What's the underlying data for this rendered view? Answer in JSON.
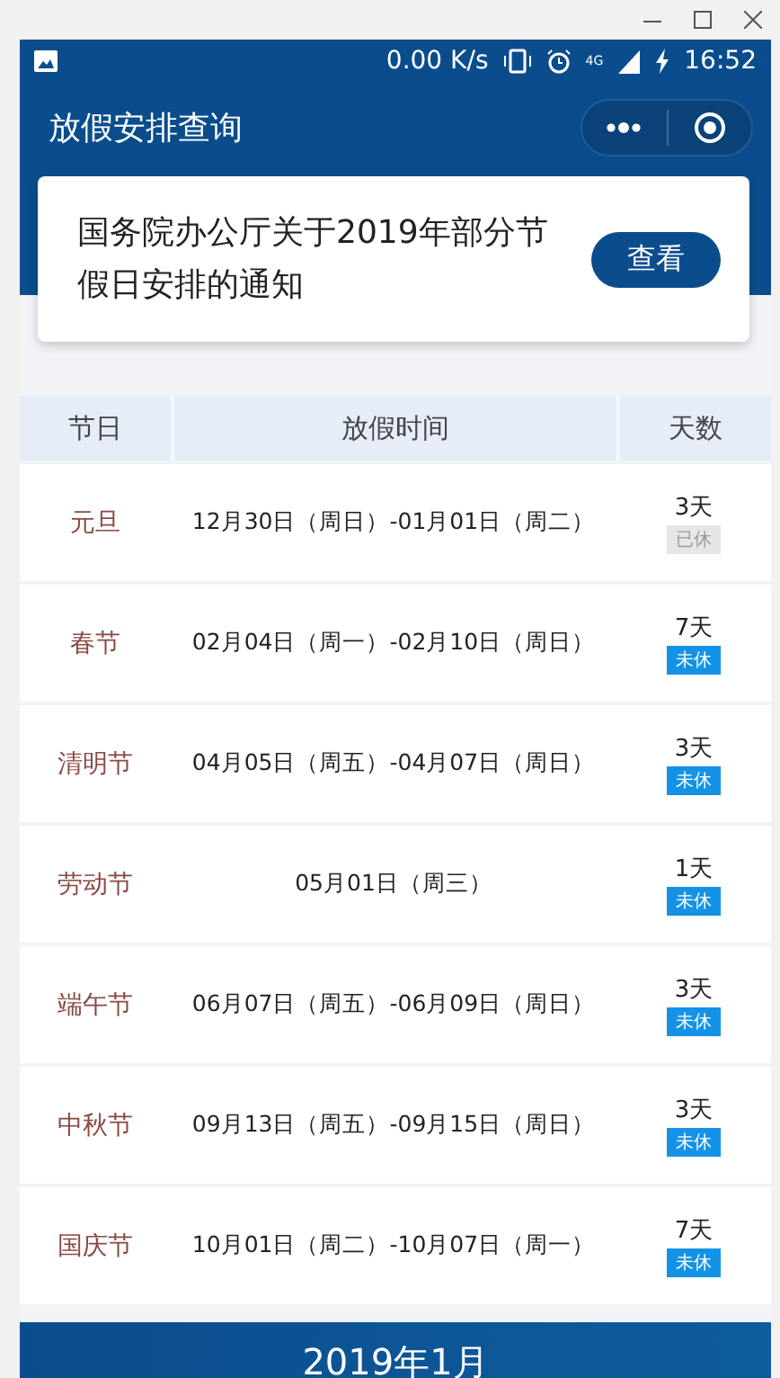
{
  "status_bar": {
    "speed": "0.00 K/s",
    "network": "4G",
    "time": "16:52"
  },
  "header": {
    "title": "放假安排查询"
  },
  "notice": {
    "text": "国务院办公厅关于2019年部分节假日安排的通知",
    "button": "查看"
  },
  "table": {
    "columns": [
      "节日",
      "放假时间",
      "天数"
    ],
    "rows": [
      {
        "holiday": "元旦",
        "period": "12月30日（周日）-01月01日（周二）",
        "days": "3天",
        "tag": "已休",
        "rested": true
      },
      {
        "holiday": "春节",
        "period": "02月04日（周一）-02月10日（周日）",
        "days": "7天",
        "tag": "未休",
        "rested": false
      },
      {
        "holiday": "清明节",
        "period": "04月05日（周五）-04月07日（周日）",
        "days": "3天",
        "tag": "未休",
        "rested": false
      },
      {
        "holiday": "劳动节",
        "period": "05月01日（周三）",
        "days": "1天",
        "tag": "未休",
        "rested": false
      },
      {
        "holiday": "端午节",
        "period": "06月07日（周五）-06月09日（周日）",
        "days": "3天",
        "tag": "未休",
        "rested": false
      },
      {
        "holiday": "中秋节",
        "period": "09月13日（周五）-09月15日（周日）",
        "days": "3天",
        "tag": "未休",
        "rested": false
      },
      {
        "holiday": "国庆节",
        "period": "10月01日（周二）-10月07日（周一）",
        "days": "7天",
        "tag": "未休",
        "rested": false
      }
    ]
  },
  "month_banner": {
    "title": "2019年1月"
  }
}
